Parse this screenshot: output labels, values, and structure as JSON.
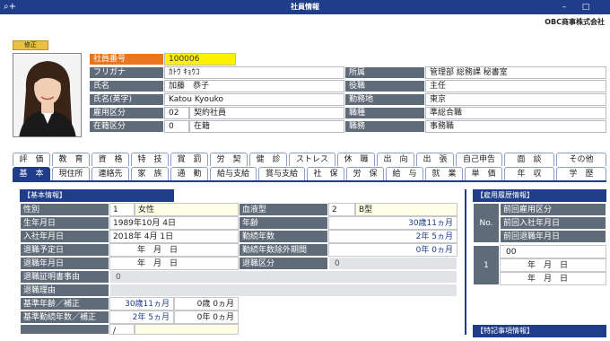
{
  "window": {
    "title": "社員情報",
    "company": "OBC商事株式会社",
    "app_icon": "search-plus-icon",
    "min_icon": "minimize-icon",
    "max_icon": "maximize-icon"
  },
  "edit_badge": "修正",
  "header": {
    "emp_no_label": "社員番号",
    "emp_no": "100006",
    "kana_label": "フリガナ",
    "kana": "ｶﾄｳ ｷｮｳｺ",
    "name_label": "氏名",
    "name": "加藤　恭子",
    "name_en_label": "氏名(英字)",
    "name_en": "Katou Kyouko",
    "emp_type_label": "雇用区分",
    "emp_type_code": "02",
    "emp_type": "契約社員",
    "status_label": "在籍区分",
    "status_code": "0",
    "status": "在籍",
    "dept_label": "所属",
    "dept": "管理部 総務課 秘書室",
    "role_label": "役職",
    "role": "主任",
    "location_label": "勤務地",
    "location": "東京",
    "job_type_label": "職種",
    "job_type": "準総合職",
    "duty_label": "職務",
    "duty": "事務職"
  },
  "tabs_row1": [
    "評　価",
    "教　育",
    "資　格",
    "特　技",
    "賞　罰",
    "労　契",
    "健　診",
    "ストレス",
    "休　職",
    "出　向",
    "出　張",
    "自己申告",
    "面　談",
    "その他"
  ],
  "tabs_row2": [
    "基　本",
    "現住所",
    "連絡先",
    "家　族",
    "通　勤",
    "給与支給",
    "賞与支給",
    "社　保",
    "労　保",
    "給　与",
    "就　業",
    "単　価",
    "年　収",
    "学　歴"
  ],
  "basic": {
    "section_title": "【基本情報】",
    "gender_label": "性別",
    "gender_code": "1",
    "gender": "女性",
    "blood_label": "血液型",
    "blood_code": "2",
    "blood": "B型",
    "birth_label": "生年月日",
    "birth": "1989年10月 4日",
    "age_label": "年齢",
    "age": "30歳11ヵ月",
    "join_label": "入社年月日",
    "join": "2018年 4月 1日",
    "tenure_label": "勤続年数",
    "tenure": "2年 5ヵ月",
    "retire_plan_label": "退職予定日",
    "retire_plan": "年　月　日",
    "tenure_ex_label": "勤続年数除外期間",
    "tenure_ex": "0年 0ヵ月",
    "retire_label": "退職年月日",
    "retire": "年　月　日",
    "retire_type_label": "退職区分",
    "retire_type": "0",
    "cert_label": "退職証明書事由",
    "cert": "0",
    "reason_label": "退職理由",
    "base_age_label": "基準年齢／補正",
    "base_age": "30歳11ヵ月",
    "base_age_adj": "0歳 0ヵ月",
    "base_tenure_label": "基準勤続年数／補正",
    "base_tenure": "2年 5ヵ月",
    "base_tenure_adj": "0年 0ヵ月",
    "last_code": "/"
  },
  "history": {
    "section_title": "【雇用履歴情報】",
    "no_label": "No.",
    "prev_type_label": "前回雇用区分",
    "prev_join_label": "前回入社年月日",
    "prev_retire_label": "前回退職年月日",
    "row_no": "1",
    "row_code": "00",
    "row_join": "年　月　日",
    "row_retire": "年　月　日"
  },
  "notes": {
    "section_title": "【特記事項情報】"
  }
}
